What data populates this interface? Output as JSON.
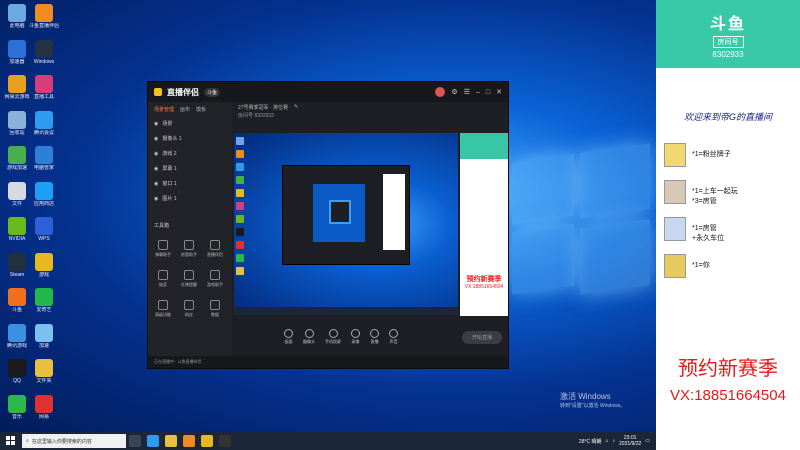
{
  "desktop": {
    "icons": [
      {
        "label": "此电脑",
        "color": "#6ea8e0"
      },
      {
        "label": "斗鱼直播伴侣",
        "color": "#f08a22"
      },
      {
        "label": "加速器",
        "color": "#2c6fd6"
      },
      {
        "label": "Windows",
        "color": "#223344"
      },
      {
        "label": "网易云游戏",
        "color": "#e8a020"
      },
      {
        "label": "直播工具",
        "color": "#d63d7a"
      },
      {
        "label": "回收站",
        "color": "#8ab2d8"
      },
      {
        "label": "腾讯会议",
        "color": "#2d9cf0"
      },
      {
        "label": "游戏加速",
        "color": "#48b04a"
      },
      {
        "label": "电脑管家",
        "color": "#2e7fd6"
      },
      {
        "label": "文件",
        "color": "#d8d8e0"
      },
      {
        "label": "应用商店",
        "color": "#1ea0f2"
      },
      {
        "label": "NVIDIA",
        "color": "#6ab820"
      },
      {
        "label": "WPS",
        "color": "#2d5fd6"
      },
      {
        "label": "Steam",
        "color": "#20303f"
      },
      {
        "label": "游戏",
        "color": "#e8b820"
      },
      {
        "label": "斗鱼",
        "color": "#f07020"
      },
      {
        "label": "爱奇艺",
        "color": "#22b84a"
      },
      {
        "label": "腾讯游戏",
        "color": "#3d8fe0"
      },
      {
        "label": "加速",
        "color": "#7ac0f0"
      },
      {
        "label": "QQ",
        "color": "#1a1a1a"
      },
      {
        "label": "文件夹",
        "color": "#e8c040"
      },
      {
        "label": "音乐",
        "color": "#2cb84a"
      },
      {
        "label": "网易",
        "color": "#e03030"
      }
    ],
    "activation_title": "激活 Windows",
    "activation_sub": "转到\"设置\"以激活 Windows。"
  },
  "taskbar": {
    "search_placeholder": "在这里输入你要搜索的内容",
    "weather": "28°C 晴朗",
    "time": "23:01",
    "date": "2021/9/22"
  },
  "app": {
    "name": "直播伴侣",
    "badge": "斗鱼",
    "tabs": [
      "场景管理",
      "画布",
      "模板"
    ],
    "scenes": [
      "场景",
      "摄像头 1",
      "游戏 2",
      "屏幕 1",
      "窗口 1",
      "图片 1"
    ],
    "tools_title": "工具箱",
    "tools": [
      "弹幕助手",
      "房管助手",
      "直播伴侣",
      "抽奖",
      "礼物提醒",
      "游戏助手",
      "高级功能",
      "粉丝",
      "数据"
    ],
    "room_title": "27号赛季冠军 · 排位赛",
    "room_info": "房间号 8302933",
    "bottom_buttons": [
      "画面",
      "摄像头",
      "手机投屏",
      "录像",
      "直播",
      "声音"
    ],
    "live_button": "开始直播",
    "status_text": "正在直播中 · 斗鱼直播伴侣",
    "side_text1": "预约新赛季",
    "side_text2": "VX:18851664504"
  },
  "overlay": {
    "brand": "斗鱼",
    "room_label": "房间号",
    "room_number": "8302933",
    "welcome": "欢迎来到帝G的直播间",
    "gifts": [
      {
        "line1": "*1=粉丝牌子",
        "line2": ""
      },
      {
        "line1": "*1=上车一起玩",
        "line2": "*3=房管"
      },
      {
        "line1": "*1=房管",
        "line2": "+永久车位"
      },
      {
        "line1": "*1=你",
        "line2": ""
      }
    ],
    "season": "预约新赛季",
    "vx": "VX:18851664504"
  }
}
